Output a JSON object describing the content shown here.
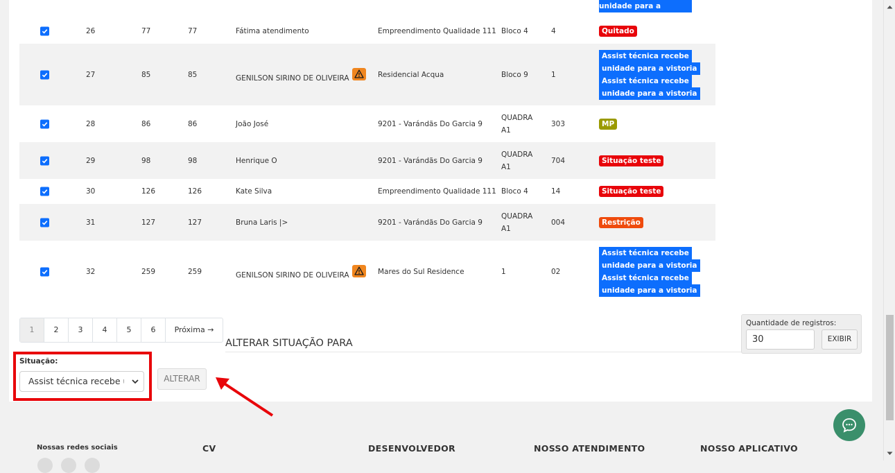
{
  "table": {
    "top_partial_badge": "unidade para a vistoria",
    "rows": [
      {
        "id": "26",
        "a": "77",
        "b": "77",
        "name": "Fátima atendimento",
        "emp": "Empreendimento Qualidade 111",
        "bloco": "Bloco 4",
        "unid": "4",
        "badge": "Quitado"
      },
      {
        "id": "27",
        "a": "85",
        "b": "85",
        "name": "GENILSON SIRINO DE OLIVEIRA",
        "emp": "Residencial Acqua",
        "bloco": "Bloco 9",
        "unid": "1",
        "badge_lines": [
          "Assist técnica recebe",
          "unidade para a vistoria",
          "Assist técnica recebe",
          "unidade para a vistoria"
        ]
      },
      {
        "id": "28",
        "a": "86",
        "b": "86",
        "name": "João José",
        "emp": "9201 - Varándãs Do Garcia 9",
        "bloco_1": "QUADRA",
        "bloco_2": "A1",
        "unid": "303",
        "badge": "MP"
      },
      {
        "id": "29",
        "a": "98",
        "b": "98",
        "name": "Henrique O",
        "emp": "9201 - Varándãs Do Garcia 9",
        "bloco_1": "QUADRA",
        "bloco_2": "A1",
        "unid": "704",
        "badge": "Situação teste"
      },
      {
        "id": "30",
        "a": "126",
        "b": "126",
        "name": "Kate Silva",
        "emp": "Empreendimento Qualidade 111",
        "bloco": "Bloco 4",
        "unid": "14",
        "badge": "Situação teste"
      },
      {
        "id": "31",
        "a": "127",
        "b": "127",
        "name": "Bruna Laris |>",
        "emp": "9201 - Varándãs Do Garcia 9",
        "bloco_1": "QUADRA",
        "bloco_2": "A1",
        "unid": "004",
        "badge": "Restrição"
      },
      {
        "id": "32",
        "a": "259",
        "b": "259",
        "name": "GENILSON SIRINO DE OLIVEIRA",
        "emp": "Mares do Sul Residence",
        "bloco": "1",
        "unid": "02",
        "badge_lines": [
          "Assist técnica recebe",
          "unidade para a vistoria",
          "Assist técnica recebe",
          "unidade para a vistoria"
        ]
      }
    ]
  },
  "pagination": {
    "pages": [
      "1",
      "2",
      "3",
      "4",
      "5",
      "6"
    ],
    "next": "Próxima →"
  },
  "alterar": {
    "title": "ALTERAR SITUAÇÃO PARA",
    "situacao_label": "Situação:",
    "situacao_value": "Assist técnica recebe unidade para a vistoria",
    "button": "ALTERAR"
  },
  "registros": {
    "label": "Quantidade de registros:",
    "value": "30",
    "button": "EXIBIR"
  },
  "footer": {
    "social": "Nossas redes sociais",
    "cv": "CV",
    "dev": "DESENVOLVEDOR",
    "atend": "NOSSO ATENDIMENTO",
    "app": "NOSSO APLICATIVO"
  },
  "colors": {
    "checkbox": "#0d6efd",
    "badge_red": "#e8050a",
    "badge_orange": "#ef4b0d",
    "badge_olive": "#9a9a00",
    "highlight": "#e8050a",
    "chat": "#3a8f6b"
  }
}
